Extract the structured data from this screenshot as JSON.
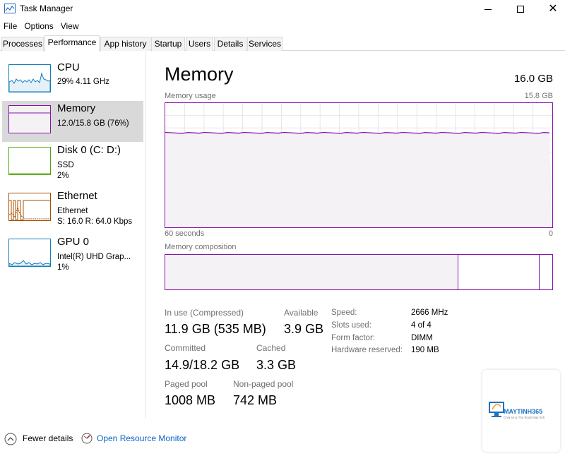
{
  "window": {
    "title": "Task Manager"
  },
  "menu": [
    "File",
    "Options",
    "View"
  ],
  "tabs": [
    {
      "label": "Processes",
      "active": false
    },
    {
      "label": "Performance",
      "active": true
    },
    {
      "label": "App history",
      "active": false
    },
    {
      "label": "Startup",
      "active": false
    },
    {
      "label": "Users",
      "active": false
    },
    {
      "label": "Details",
      "active": false
    },
    {
      "label": "Services",
      "active": false
    }
  ],
  "sidebar": {
    "items": [
      {
        "title": "CPU",
        "sub1": "29%  4.11 GHz",
        "color": "#117dbb"
      },
      {
        "title": "Memory",
        "sub1": "12.0/15.8 GB (76%)",
        "color": "#8b12ae",
        "selected": true
      },
      {
        "title": "Disk 0 (C: D:)",
        "sub1": "SSD",
        "sub2": "2%",
        "color": "#4da60c"
      },
      {
        "title": "Ethernet",
        "sub1": "Ethernet",
        "sub2": "S: 16.0  R: 64.0 Kbps",
        "color": "#a74f01"
      },
      {
        "title": "GPU 0",
        "sub1": "Intel(R) UHD Grap...",
        "sub2": "1%",
        "color": "#117dbb"
      }
    ]
  },
  "main": {
    "heading": "Memory",
    "total": "16.0 GB",
    "usage_label": "Memory usage",
    "usage_max": "15.8 GB",
    "time_left": "60 seconds",
    "time_right": "0",
    "composition_label": "Memory composition",
    "usage_percent": 76,
    "stats": {
      "in_use_label": "In use (Compressed)",
      "in_use_value": "11.9 GB (535 MB)",
      "available_label": "Available",
      "available_value": "3.9 GB",
      "committed_label": "Committed",
      "committed_value": "14.9/18.2 GB",
      "cached_label": "Cached",
      "cached_value": "3.3 GB",
      "paged_label": "Paged pool",
      "paged_value": "1008 MB",
      "nonpaged_label": "Non-paged pool",
      "nonpaged_value": "742 MB"
    },
    "specs": [
      {
        "label": "Speed:",
        "value": "2666 MHz"
      },
      {
        "label": "Slots used:",
        "value": "4 of 4"
      },
      {
        "label": "Form factor:",
        "value": "DIMM"
      },
      {
        "label": "Hardware reserved:",
        "value": "190 MB"
      }
    ]
  },
  "footer": {
    "fewer_details": "Fewer details",
    "resource_monitor": "Open Resource Monitor"
  },
  "watermark": {
    "name": "MAYTINH365",
    "tagline": "Chia sẻ & Thủ thuật Máy tính"
  },
  "colors": {
    "memory": "#8b12ae",
    "cpu": "#117dbb",
    "disk": "#4da60c",
    "ethernet": "#a74f01",
    "link": "#0a64c8"
  }
}
